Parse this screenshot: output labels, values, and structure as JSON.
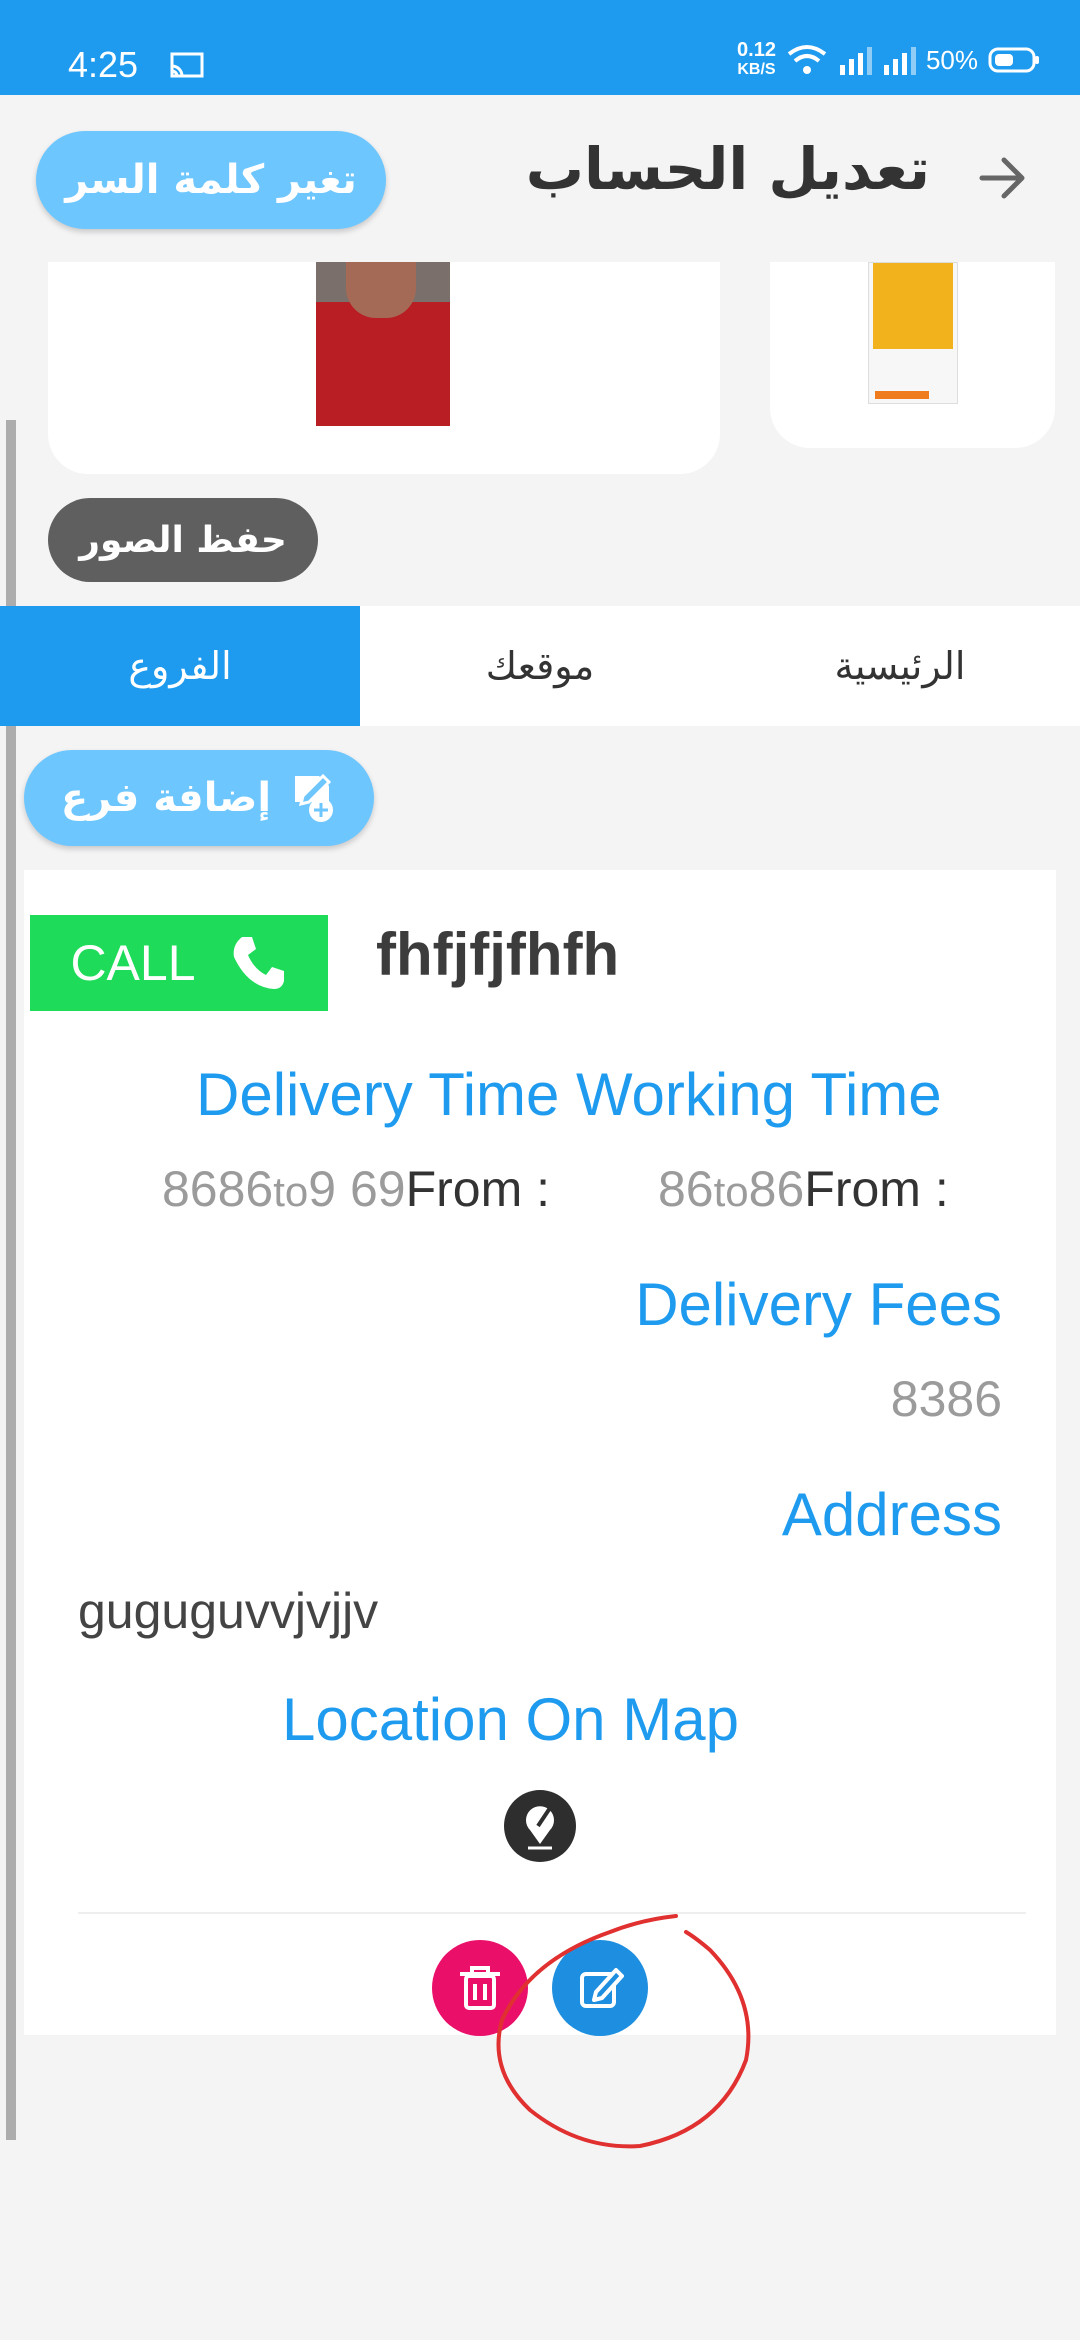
{
  "status_bar": {
    "time": "4:25",
    "net_speed": "0.12",
    "net_unit": "KB/S",
    "battery": "50%"
  },
  "header": {
    "title": "تعديل الحساب",
    "change_password": "تغير كلمة السر"
  },
  "images": {
    "save_label": "حفظ الصور"
  },
  "tabs": [
    {
      "label": "الرئيسية",
      "active": false
    },
    {
      "label": "موقعك",
      "active": false
    },
    {
      "label": "الفروع",
      "active": true
    }
  ],
  "add_branch_label": "إضافة فرع",
  "branch": {
    "name": "fhfjfjfhfh",
    "call_label": "CALL",
    "working_time": {
      "heading": "Working Time",
      "from_label": "From :",
      "from": "86",
      "to_word": "to",
      "to": "86"
    },
    "delivery_time": {
      "heading": "Delivery Time",
      "from_label": "From :",
      "from": "8686",
      "to_word": "to",
      "to": "9 69"
    },
    "delivery_fees": {
      "heading": "Delivery Fees",
      "value": "8386"
    },
    "address": {
      "heading": "Address",
      "value": "guguguvvjvjjv"
    },
    "location": {
      "heading": "Location On Map"
    }
  },
  "colors": {
    "primary": "#1e9bef",
    "light_blue": "#6ec6ff",
    "call_green": "#1edc5a",
    "delete_pink": "#ea1069"
  }
}
